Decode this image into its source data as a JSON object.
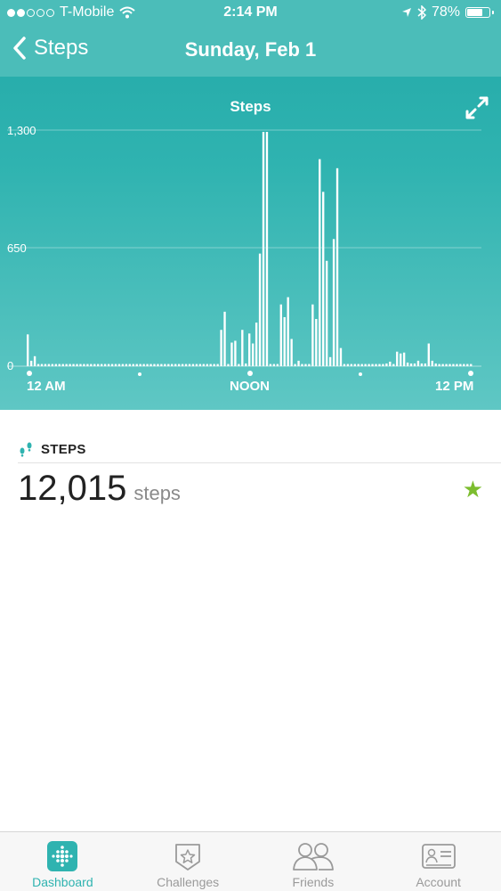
{
  "status_bar": {
    "carrier": "T-Mobile",
    "time": "2:14 PM",
    "battery_text": "78%",
    "battery_level": 0.78,
    "signal_bars_filled": 2,
    "signal_bars_total": 5
  },
  "nav": {
    "back_label": "Steps",
    "title": "Sunday, Feb 1"
  },
  "colors": {
    "header_teal": "#2fb3b0",
    "accent_green": "#7cbd2e",
    "tab_active": "#2fb3b0",
    "tab_inactive": "#9a9a9a"
  },
  "chart_data": {
    "type": "bar",
    "title": "Steps",
    "y_ticks": [
      "1,300",
      "650",
      "0"
    ],
    "ylim": [
      0,
      1300
    ],
    "x_tick_labels": [
      "12 AM",
      "NOON",
      "12 PM"
    ],
    "grid": true,
    "interval": "15 min",
    "values": [
      175,
      30,
      55,
      12,
      12,
      12,
      12,
      12,
      12,
      12,
      12,
      12,
      12,
      12,
      12,
      12,
      12,
      12,
      12,
      12,
      12,
      12,
      12,
      12,
      12,
      12,
      12,
      12,
      12,
      12,
      12,
      12,
      12,
      12,
      12,
      12,
      12,
      12,
      12,
      12,
      12,
      12,
      12,
      12,
      12,
      12,
      12,
      12,
      12,
      12,
      12,
      12,
      12,
      12,
      12,
      200,
      300,
      12,
      130,
      140,
      12,
      200,
      15,
      180,
      125,
      240,
      620,
      1290,
      1290,
      12,
      12,
      12,
      340,
      270,
      380,
      150,
      12,
      30,
      12,
      12,
      12,
      340,
      260,
      1140,
      960,
      580,
      50,
      700,
      1090,
      100,
      12,
      12,
      12,
      12,
      12,
      12,
      12,
      12,
      12,
      12,
      12,
      12,
      15,
      25,
      12,
      80,
      70,
      75,
      20,
      15,
      15,
      30,
      15,
      15,
      125,
      30,
      15,
      12,
      12,
      12,
      12,
      12,
      12,
      12,
      12,
      12,
      12
    ]
  },
  "steps_section": {
    "heading": "STEPS",
    "value": "12,015",
    "unit": "steps",
    "goal_star": "★"
  },
  "tab_bar": {
    "tabs": [
      {
        "label": "Dashboard",
        "icon": "dashboard-icon",
        "active": true
      },
      {
        "label": "Challenges",
        "icon": "challenges-icon",
        "active": false
      },
      {
        "label": "Friends",
        "icon": "friends-icon",
        "active": false
      },
      {
        "label": "Account",
        "icon": "account-icon",
        "active": false
      }
    ]
  }
}
